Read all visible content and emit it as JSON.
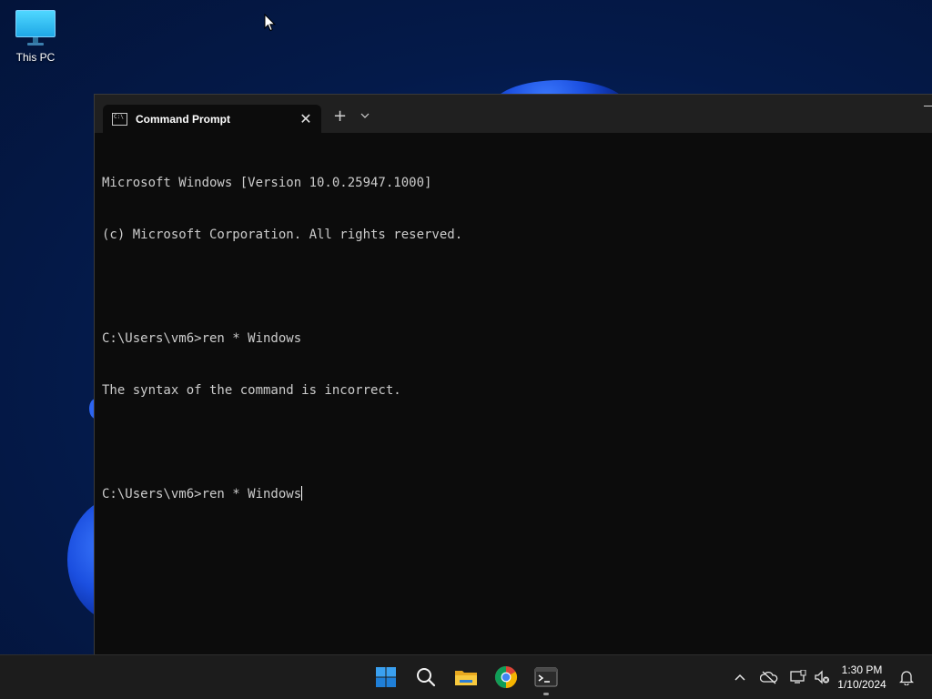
{
  "desktop": {
    "icons": [
      {
        "label": "This PC",
        "icon": "monitor-icon"
      }
    ]
  },
  "window": {
    "tab_title": "Command Prompt",
    "tab_icon": "cmd-icon",
    "close_glyph": "✕",
    "new_tab_glyph": "+",
    "dropdown_glyph": "⌄",
    "console_lines": [
      "Microsoft Windows [Version 10.0.25947.1000]",
      "(c) Microsoft Corporation. All rights reserved.",
      "",
      "C:\\Users\\vm6>ren * Windows",
      "The syntax of the command is incorrect.",
      "",
      "C:\\Users\\vm6>ren * Windows"
    ],
    "console_color": "#cccccc",
    "background": "#0c0c0c"
  },
  "taskbar": {
    "pinned": [
      {
        "name": "start-button",
        "icon": "windows-logo-icon"
      },
      {
        "name": "search-button",
        "icon": "search-icon"
      },
      {
        "name": "file-explorer-button",
        "icon": "folder-icon"
      },
      {
        "name": "chrome-button",
        "icon": "chrome-icon"
      },
      {
        "name": "terminal-button",
        "icon": "terminal-icon",
        "active": true
      }
    ],
    "tray": {
      "icons": [
        "chevron-up-icon",
        "onedrive-icon",
        "network-icon",
        "volume-muted-icon",
        "notification-bell-icon"
      ],
      "time": "1:30 PM",
      "date": "1/10/2024"
    }
  },
  "colors": {
    "accent": "#0078d4",
    "taskbar": "#1c1c1c",
    "titlebar": "#202020"
  }
}
